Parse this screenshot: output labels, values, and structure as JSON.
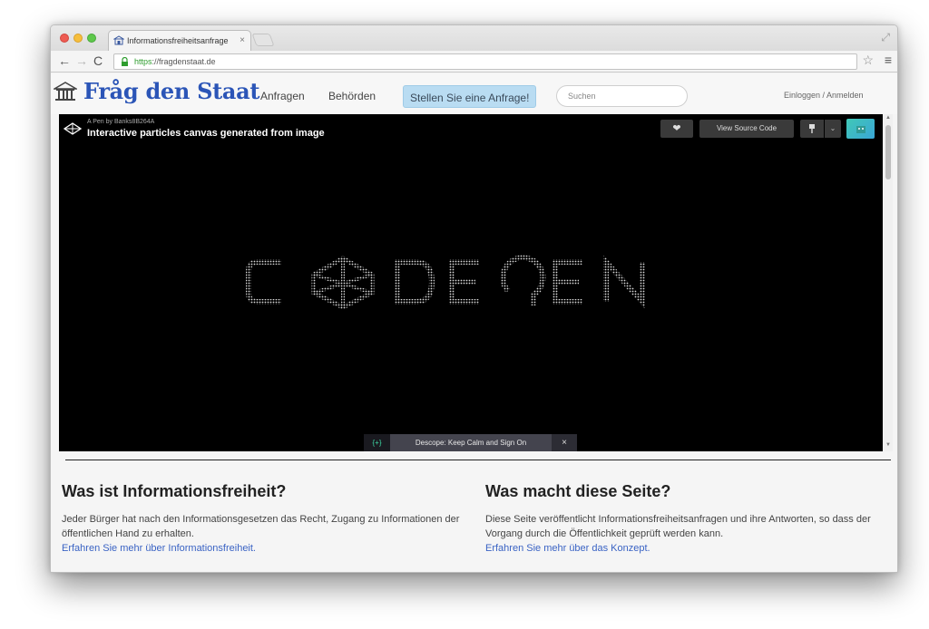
{
  "browser": {
    "tab_title": "Informationsfreiheitsanfrage",
    "tab_close": "×",
    "url_scheme": "https",
    "url_rest": "://fragdenstaat.de",
    "nav": {
      "back": "←",
      "forward": "→",
      "reload": "C"
    },
    "star": "☆",
    "menu": "≡",
    "fullscreen": "⤢"
  },
  "site": {
    "logo": "Fråg den Staat",
    "nav": [
      "Anfragen",
      "Behörden"
    ],
    "cta": "Stellen Sie eine Anfrage!",
    "search_placeholder": "Suchen",
    "login": "Einloggen / Anmelden"
  },
  "embed": {
    "author": "A Pen by Banks8B264A",
    "title": "Interactive particles canvas generated from image",
    "heart": "❤",
    "source_button": "View Source Code",
    "dropdown": "⌄",
    "ad_icon": "{+}",
    "ad_text": "Descope: Keep Calm and Sign On",
    "ad_close": "×"
  },
  "scroll": {
    "up": "▲",
    "down": "▼"
  },
  "info": {
    "left": {
      "heading": "Was ist Informationsfreiheit?",
      "body": "Jeder Bürger hat nach den Informationsgesetzen das Recht, Zugang zu Informationen der öffentlichen Hand zu erhalten.",
      "link": "Erfahren Sie mehr über Informationsfreiheit."
    },
    "right": {
      "heading": "Was macht diese Seite?",
      "body": "Diese Seite veröffentlicht Informationsfreiheitsanfragen und ihre Antworten, so dass der Vorgang durch die Öffentlichkeit geprüft werden kann.",
      "link": "Erfahren Sie mehr über das Konzept."
    }
  },
  "colors": {
    "brand": "#2b55b7",
    "cta_bg": "#b9dcf2",
    "link": "#3a63c4",
    "embed_bg": "#000000",
    "secure": "#2e9d2e"
  }
}
